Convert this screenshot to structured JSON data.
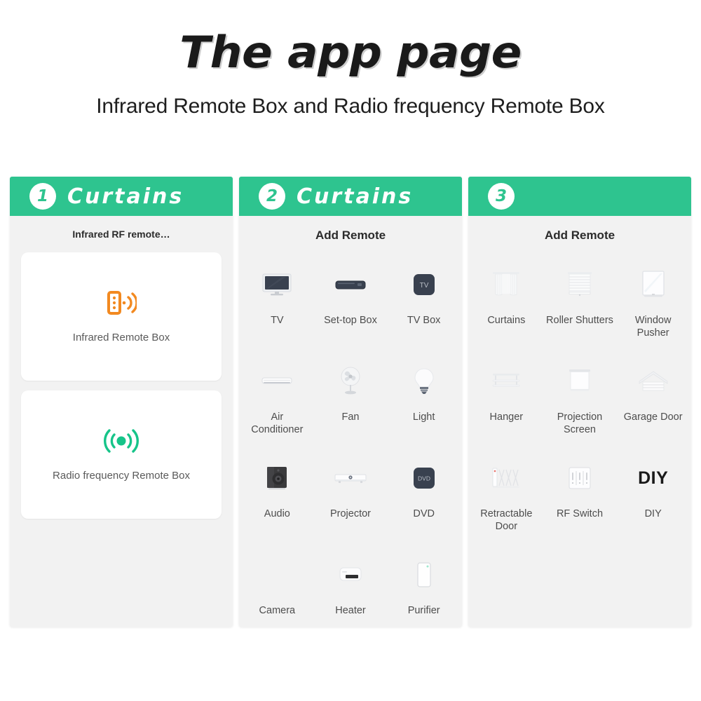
{
  "header": {
    "title": "The app page",
    "subtitle": "Infrared Remote Box and Radio frequency Remote Box"
  },
  "colors": {
    "banner_green": "#2ec48f",
    "panel_bg": "#f2f2f2",
    "card_bg": "#ffffff",
    "infrared_icon": "#f28920",
    "radio_icon": "#16c489",
    "dark_device": "#333c4a"
  },
  "panels": [
    {
      "number": "1",
      "banner_label": "Curtains",
      "heading": "Infrared RF remote…",
      "cards": [
        {
          "label": "Infrared Remote Box",
          "icon": "infrared-remote-icon"
        },
        {
          "label": "Radio frequency Remote Box",
          "icon": "radio-frequency-icon"
        }
      ]
    },
    {
      "number": "2",
      "banner_label": "Curtains",
      "heading": "Add Remote",
      "items": [
        {
          "label": "TV",
          "icon": "tv-icon"
        },
        {
          "label": "Set-top Box",
          "icon": "set-top-box-icon"
        },
        {
          "label": "TV Box",
          "icon": "tv-box-icon"
        },
        {
          "label": "Air\nConditioner",
          "icon": "air-conditioner-icon"
        },
        {
          "label": "Fan",
          "icon": "fan-icon"
        },
        {
          "label": "Light",
          "icon": "light-bulb-icon"
        },
        {
          "label": "Audio",
          "icon": "audio-speaker-icon"
        },
        {
          "label": "Projector",
          "icon": "projector-icon"
        },
        {
          "label": "DVD",
          "icon": "dvd-icon"
        },
        {
          "label": "Camera",
          "icon": "camera-icon"
        },
        {
          "label": "Heater",
          "icon": "heater-icon"
        },
        {
          "label": "Purifier",
          "icon": "purifier-icon"
        }
      ]
    },
    {
      "number": "3",
      "banner_label": "",
      "heading": "Add Remote",
      "items": [
        {
          "label": "Curtains",
          "icon": "curtains-icon"
        },
        {
          "label": "Roller Shutters",
          "icon": "roller-shutters-icon"
        },
        {
          "label": "Window\nPusher",
          "icon": "window-pusher-icon"
        },
        {
          "label": "Hanger",
          "icon": "hanger-icon"
        },
        {
          "label": "Projection\nScreen",
          "icon": "projection-screen-icon"
        },
        {
          "label": "Garage Door",
          "icon": "garage-door-icon"
        },
        {
          "label": "Retractable\nDoor",
          "icon": "retractable-door-icon"
        },
        {
          "label": "RF Switch",
          "icon": "rf-switch-icon"
        },
        {
          "label": "DIY",
          "icon": "diy-icon",
          "icon_text": "DIY"
        }
      ]
    }
  ]
}
